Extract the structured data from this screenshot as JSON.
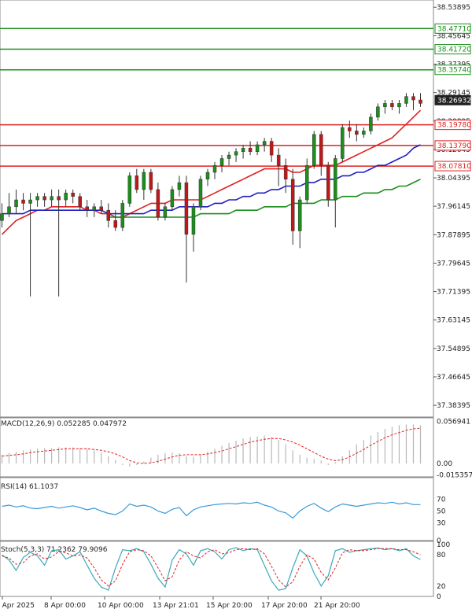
{
  "chart_data": {
    "type": "candlestick",
    "main": {
      "ylim": [
        37.35,
        38.56
      ],
      "y_ticks": [
        "38.53895",
        "38.45645",
        "38.37395",
        "38.29145",
        "38.20895",
        "38.12645",
        "38.04395",
        "37.96145",
        "37.87895",
        "37.79645",
        "37.71395",
        "37.63145",
        "37.54895",
        "37.46645",
        "37.38395"
      ],
      "current_price": "38.26932",
      "resistance_levels": [
        {
          "label": "38.47710",
          "value": 38.4771,
          "color": "#1a8f1a"
        },
        {
          "label": "38.41720",
          "value": 38.4172,
          "color": "#1a8f1a"
        },
        {
          "label": "38.35740",
          "value": 38.3574,
          "color": "#1a8f1a"
        }
      ],
      "support_levels": [
        {
          "label": "38.19780",
          "value": 38.1978,
          "color": "#e02020"
        },
        {
          "label": "38.13790",
          "value": 38.1379,
          "color": "#e02020"
        },
        {
          "label": "38.07810",
          "value": 38.0781,
          "color": "#e02020"
        }
      ],
      "candles": [
        [
          37.92,
          37.97,
          37.9,
          37.94
        ],
        [
          37.94,
          38.0,
          37.93,
          37.96
        ],
        [
          37.96,
          38.01,
          37.94,
          37.98
        ],
        [
          37.98,
          38.0,
          37.95,
          37.97
        ],
        [
          37.97,
          38.0,
          37.7,
          37.98
        ],
        [
          37.98,
          38.0,
          37.96,
          37.99
        ],
        [
          37.99,
          38.0,
          37.96,
          37.98
        ],
        [
          37.98,
          38.01,
          37.96,
          37.99
        ],
        [
          37.99,
          38.01,
          37.7,
          37.98
        ],
        [
          37.98,
          38.01,
          37.96,
          38.0
        ],
        [
          38.0,
          38.01,
          37.97,
          37.99
        ],
        [
          37.99,
          38.0,
          37.95,
          37.96
        ],
        [
          37.96,
          37.98,
          37.93,
          37.95
        ],
        [
          37.95,
          37.97,
          37.93,
          37.96
        ],
        [
          37.96,
          37.98,
          37.94,
          37.95
        ],
        [
          37.95,
          37.97,
          37.9,
          37.92
        ],
        [
          37.92,
          37.95,
          37.89,
          37.9
        ],
        [
          37.9,
          37.98,
          37.89,
          37.97
        ],
        [
          37.97,
          38.06,
          37.96,
          38.05
        ],
        [
          38.05,
          38.07,
          38.0,
          38.01
        ],
        [
          38.01,
          38.07,
          37.98,
          38.06
        ],
        [
          38.06,
          38.07,
          38.0,
          38.01
        ],
        [
          38.01,
          38.03,
          37.92,
          37.93
        ],
        [
          37.93,
          37.97,
          37.92,
          37.96
        ],
        [
          37.96,
          38.02,
          37.95,
          38.01
        ],
        [
          38.01,
          38.05,
          37.99,
          38.03
        ],
        [
          38.03,
          38.05,
          37.74,
          37.88
        ],
        [
          37.88,
          37.97,
          37.83,
          37.96
        ],
        [
          37.96,
          38.05,
          37.95,
          38.04
        ],
        [
          38.04,
          38.07,
          38.02,
          38.06
        ],
        [
          38.06,
          38.09,
          38.04,
          38.08
        ],
        [
          38.08,
          38.11,
          38.06,
          38.1
        ],
        [
          38.1,
          38.12,
          38.08,
          38.11
        ],
        [
          38.11,
          38.13,
          38.09,
          38.12
        ],
        [
          38.12,
          38.14,
          38.1,
          38.13
        ],
        [
          38.13,
          38.15,
          38.11,
          38.12
        ],
        [
          38.12,
          38.15,
          38.11,
          38.14
        ],
        [
          38.14,
          38.16,
          38.12,
          38.15
        ],
        [
          38.15,
          38.16,
          38.09,
          38.11
        ],
        [
          38.11,
          38.13,
          38.02,
          38.08
        ],
        [
          38.08,
          38.1,
          38.0,
          38.04
        ],
        [
          38.04,
          38.07,
          37.85,
          37.89
        ],
        [
          37.89,
          37.99,
          37.84,
          37.98
        ],
        [
          37.98,
          38.1,
          37.97,
          38.08
        ],
        [
          38.08,
          38.18,
          38.07,
          38.17
        ],
        [
          38.17,
          38.18,
          38.05,
          38.08
        ],
        [
          38.08,
          38.09,
          37.96,
          37.98
        ],
        [
          37.98,
          38.11,
          37.9,
          38.1
        ],
        [
          38.1,
          38.2,
          38.09,
          38.19
        ],
        [
          38.19,
          38.21,
          38.16,
          38.18
        ],
        [
          38.18,
          38.2,
          38.15,
          38.17
        ],
        [
          38.17,
          38.19,
          38.16,
          38.18
        ],
        [
          38.18,
          38.23,
          38.17,
          38.22
        ],
        [
          38.22,
          38.26,
          38.21,
          38.25
        ],
        [
          38.25,
          38.27,
          38.23,
          38.26
        ],
        [
          38.26,
          38.27,
          38.24,
          38.25
        ],
        [
          38.25,
          38.27,
          38.23,
          38.26
        ],
        [
          38.26,
          38.29,
          38.25,
          38.28
        ],
        [
          38.28,
          38.29,
          38.24,
          38.27
        ],
        [
          38.27,
          38.29,
          38.25,
          38.26
        ]
      ],
      "ma_series": [
        {
          "color": "#e02020",
          "values": [
            37.88,
            37.9,
            37.92,
            37.93,
            37.94,
            37.95,
            37.95,
            37.96,
            37.96,
            37.96,
            37.96,
            37.96,
            37.95,
            37.95,
            37.94,
            37.94,
            37.93,
            37.93,
            37.94,
            37.95,
            37.96,
            37.97,
            37.97,
            37.97,
            37.98,
            37.98,
            37.98,
            37.98,
            37.98,
            37.99,
            38.0,
            38.01,
            38.02,
            38.03,
            38.04,
            38.05,
            38.06,
            38.07,
            38.07,
            38.07,
            38.07,
            38.06,
            38.06,
            38.07,
            38.08,
            38.08,
            38.08,
            38.08,
            38.09,
            38.1,
            38.11,
            38.12,
            38.13,
            38.14,
            38.15,
            38.16,
            38.18,
            38.2,
            38.22,
            38.24
          ]
        },
        {
          "color": "#2020c0",
          "values": [
            37.94,
            37.94,
            37.94,
            37.94,
            37.95,
            37.95,
            37.95,
            37.95,
            37.95,
            37.95,
            37.95,
            37.95,
            37.95,
            37.95,
            37.95,
            37.94,
            37.94,
            37.94,
            37.94,
            37.94,
            37.94,
            37.95,
            37.95,
            37.95,
            37.95,
            37.96,
            37.96,
            37.96,
            37.96,
            37.96,
            37.97,
            37.97,
            37.98,
            37.98,
            37.99,
            37.99,
            38.0,
            38.0,
            38.01,
            38.01,
            38.02,
            38.02,
            38.02,
            38.03,
            38.03,
            38.04,
            38.04,
            38.04,
            38.05,
            38.05,
            38.06,
            38.06,
            38.07,
            38.08,
            38.08,
            38.09,
            38.1,
            38.11,
            38.13,
            38.14
          ]
        },
        {
          "color": "#1a8f1a",
          "values": [
            null,
            null,
            null,
            null,
            null,
            null,
            null,
            null,
            null,
            null,
            null,
            null,
            null,
            null,
            null,
            37.93,
            37.93,
            37.93,
            37.93,
            37.93,
            37.93,
            37.93,
            37.93,
            37.93,
            37.93,
            37.93,
            37.93,
            37.93,
            37.94,
            37.94,
            37.94,
            37.94,
            37.94,
            37.95,
            37.95,
            37.95,
            37.95,
            37.96,
            37.96,
            37.96,
            37.96,
            37.97,
            37.97,
            37.97,
            37.97,
            37.98,
            37.98,
            37.98,
            37.99,
            37.99,
            37.99,
            38.0,
            38.0,
            38.0,
            38.01,
            38.01,
            38.02,
            38.02,
            38.03,
            38.04
          ]
        }
      ],
      "x_labels": [
        "4 Apr 2025",
        "8 Apr 00:00",
        "10 Apr 00:00",
        "13 Apr 21:01",
        "15 Apr 20:00",
        "17 Apr 20:00",
        "21 Apr 20:00"
      ]
    },
    "macd": {
      "label": "MACD(12,26,9) 0.052285 0.047972",
      "ticks": [
        "0.056941",
        "0.00",
        "-0.015357"
      ],
      "ylim": [
        -0.018,
        0.062
      ],
      "histogram": [
        0.012,
        0.014,
        0.016,
        0.018,
        0.019,
        0.02,
        0.021,
        0.021,
        0.022,
        0.022,
        0.022,
        0.021,
        0.02,
        0.018,
        0.015,
        0.01,
        0.005,
        -0.002,
        -0.004,
        -0.002,
        0.003,
        0.008,
        0.012,
        0.014,
        0.015,
        0.014,
        0.01,
        0.009,
        0.012,
        0.016,
        0.02,
        0.024,
        0.028,
        0.031,
        0.034,
        0.036,
        0.037,
        0.038,
        0.036,
        0.032,
        0.026,
        0.018,
        0.012,
        0.008,
        0.006,
        0.004,
        -0.002,
        0.002,
        0.01,
        0.018,
        0.026,
        0.032,
        0.038,
        0.043,
        0.047,
        0.05,
        0.052,
        0.053,
        0.053,
        0.052
      ],
      "signal": [
        0.01,
        0.011,
        0.012,
        0.013,
        0.015,
        0.016,
        0.017,
        0.018,
        0.019,
        0.02,
        0.02,
        0.02,
        0.02,
        0.019,
        0.018,
        0.016,
        0.013,
        0.009,
        0.004,
        0.001,
        0.0,
        0.001,
        0.003,
        0.006,
        0.009,
        0.011,
        0.012,
        0.012,
        0.012,
        0.013,
        0.015,
        0.017,
        0.02,
        0.023,
        0.026,
        0.029,
        0.031,
        0.033,
        0.034,
        0.034,
        0.032,
        0.029,
        0.025,
        0.02,
        0.015,
        0.01,
        0.006,
        0.004,
        0.005,
        0.009,
        0.014,
        0.019,
        0.025,
        0.03,
        0.035,
        0.039,
        0.042,
        0.045,
        0.047,
        0.048
      ]
    },
    "rsi": {
      "label": "RSI(14) 61.1037",
      "ticks": [
        "70",
        "50",
        "30",
        "0"
      ],
      "ylim": [
        0,
        100
      ],
      "values": [
        58,
        60,
        57,
        59,
        55,
        54,
        56,
        58,
        55,
        57,
        59,
        56,
        52,
        55,
        50,
        46,
        44,
        50,
        62,
        58,
        60,
        57,
        50,
        46,
        53,
        56,
        42,
        52,
        57,
        59,
        61,
        62,
        63,
        62,
        64,
        63,
        65,
        60,
        57,
        50,
        47,
        38,
        50,
        58,
        63,
        55,
        49,
        57,
        62,
        60,
        58,
        60,
        62,
        64,
        63,
        65,
        62,
        64,
        61,
        61
      ]
    },
    "stoch": {
      "label": "Stoch(5,3,3) 71.2362 79.9096",
      "ticks": [
        "100",
        "80",
        "20",
        "0"
      ],
      "ylim": [
        0,
        100
      ],
      "k": [
        80,
        70,
        50,
        75,
        85,
        78,
        60,
        88,
        90,
        72,
        78,
        86,
        60,
        35,
        18,
        12,
        55,
        90,
        88,
        92,
        86,
        62,
        35,
        18,
        70,
        90,
        82,
        60,
        88,
        92,
        86,
        72,
        90,
        94,
        88,
        92,
        90,
        60,
        30,
        12,
        15,
        55,
        90,
        78,
        45,
        20,
        40,
        88,
        92,
        85,
        88,
        90,
        92,
        93,
        90,
        92,
        88,
        92,
        78,
        71
      ],
      "d": [
        78,
        74,
        62,
        65,
        78,
        82,
        72,
        76,
        86,
        84,
        78,
        80,
        74,
        55,
        32,
        20,
        30,
        62,
        86,
        90,
        88,
        78,
        55,
        30,
        38,
        70,
        86,
        78,
        74,
        86,
        90,
        82,
        84,
        90,
        92,
        90,
        92,
        82,
        58,
        32,
        18,
        28,
        58,
        80,
        72,
        46,
        32,
        55,
        84,
        90,
        88,
        88,
        90,
        92,
        92,
        92,
        90,
        90,
        86,
        80
      ]
    }
  }
}
